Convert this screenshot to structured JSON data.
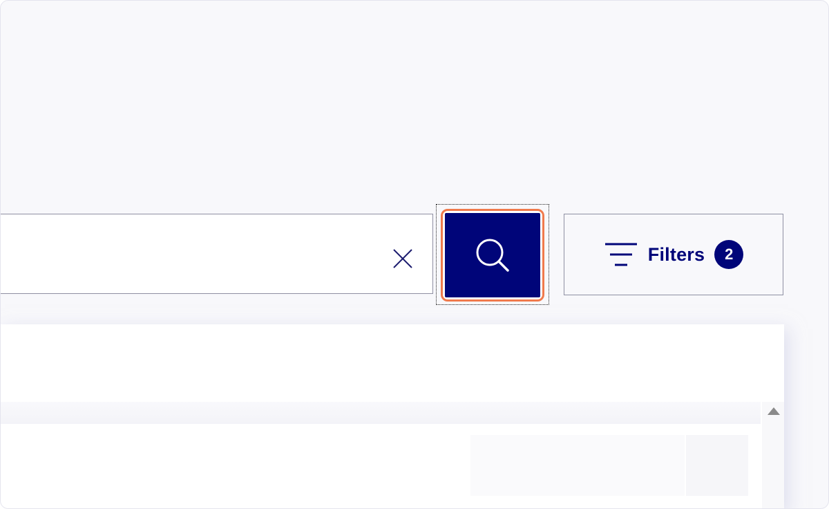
{
  "search": {
    "value": "",
    "placeholder": ""
  },
  "icons": {
    "clear": "close-icon",
    "search": "search-icon",
    "filter": "filter-lines-icon"
  },
  "filters": {
    "label": "Filters",
    "count": "2"
  },
  "colors": {
    "primary": "#000579",
    "focus_ring": "#f07a4c",
    "border": "#8e8fa2",
    "background": "#f8f8fb"
  }
}
